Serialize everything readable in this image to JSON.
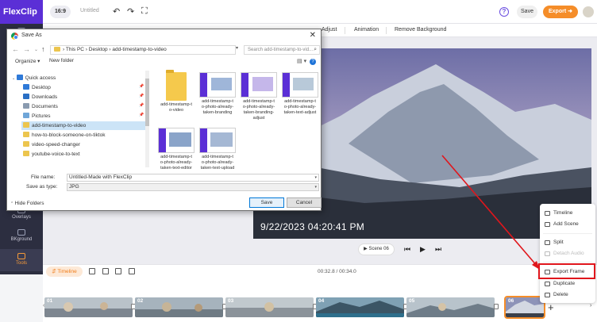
{
  "app": {
    "logo": "FlexClip",
    "aspect_ratio": "16:9",
    "project_title": "Untitled",
    "save_label": "Save",
    "export_label": "Export ➜",
    "accent_color": "#5b2fd6",
    "export_color": "#f58d29"
  },
  "sidebar": {
    "items": [
      {
        "label": "",
        "icon": "media-icon"
      },
      {
        "label": "",
        "icon": "template-icon"
      },
      {
        "label": "",
        "icon": "text-icon"
      },
      {
        "label": "",
        "icon": "subtitle-icon"
      },
      {
        "label": "",
        "icon": "element-icon"
      },
      {
        "label": "",
        "icon": "audio-icon"
      },
      {
        "label": "",
        "icon": "effect-icon"
      },
      {
        "label": "",
        "icon": "transition-icon"
      },
      {
        "label": "Overlays",
        "icon": "overlays-icon"
      },
      {
        "label": "BKground",
        "icon": "background-icon"
      },
      {
        "label": "Tools",
        "icon": "tools-icon"
      }
    ]
  },
  "tabs": [
    "Adjust",
    "Animation",
    "Remove Background"
  ],
  "canvas": {
    "timestamp_text": "9/22/2023 04:20:41 PM",
    "scene_label": "Scene 06"
  },
  "context_menu": {
    "items": [
      {
        "label": "Timeline",
        "icon": "timeline-icon",
        "disabled": false
      },
      {
        "label": "Add Scene",
        "icon": "add-scene-icon",
        "disabled": false
      },
      {
        "label": "Split",
        "icon": "split-icon",
        "disabled": false
      },
      {
        "label": "Detach Audio",
        "icon": "detach-audio-icon",
        "disabled": true
      },
      {
        "label": "Export Frame",
        "icon": "export-frame-icon",
        "disabled": false
      },
      {
        "label": "Duplicate",
        "icon": "duplicate-icon",
        "disabled": false
      },
      {
        "label": "Delete",
        "icon": "delete-icon",
        "disabled": false
      }
    ]
  },
  "timeline": {
    "label": "Timeline",
    "time_display": "00:32.8 / 00:34.0",
    "clips": [
      {
        "num": "01",
        "dur": ""
      },
      {
        "num": "02",
        "dur": ""
      },
      {
        "num": "03",
        "dur": ""
      },
      {
        "num": "04",
        "dur": ""
      },
      {
        "num": "05",
        "dur": ""
      },
      {
        "num": "06",
        "dur": ""
      }
    ]
  },
  "dialog": {
    "title": "Save As",
    "address": [
      "This PC",
      "Desktop",
      "add-timestamp-to-video"
    ],
    "search_placeholder": "Search add-timestamp-to-vid...",
    "organize_label": "Organize ▾",
    "new_folder_label": "New folder",
    "nav_items": [
      {
        "label": "Quick access",
        "icon": "star-icon"
      },
      {
        "label": "Desktop",
        "icon": "desktop-icon"
      },
      {
        "label": "Downloads",
        "icon": "downloads-icon"
      },
      {
        "label": "Documents",
        "icon": "documents-icon"
      },
      {
        "label": "Pictures",
        "icon": "pictures-icon"
      },
      {
        "label": "add-timestamp-to-video",
        "icon": "folder-icon"
      },
      {
        "label": "how-to-block-someone-on-tiktok",
        "icon": "folder-icon"
      },
      {
        "label": "video-speed-changer",
        "icon": "folder-icon"
      },
      {
        "label": "youtube-voice-to-text",
        "icon": "folder-icon"
      }
    ],
    "files": [
      {
        "name": "add-timestamp-t\no-video",
        "kind": "folder"
      },
      {
        "name": "add-timestamp-t\no-photo-already-\ntaken-branding",
        "kind": "image"
      },
      {
        "name": "add-timestamp-t\no-photo-already-\ntaken-branding-\nadjust",
        "kind": "image"
      },
      {
        "name": "add-timestamp-t\no-photo-already-\ntaken-text-adjust",
        "kind": "image"
      },
      {
        "name": "add-timestamp-t\no-photo-already-\ntaken-text-editor",
        "kind": "image"
      },
      {
        "name": "add-timestamp-t\no-photo-already-\ntaken-text-upload",
        "kind": "image"
      }
    ],
    "file_name_label": "File name:",
    "file_name_value": "Untitled-Made with FlexClip",
    "save_type_label": "Save as type:",
    "save_type_value": "JPG",
    "hide_folders_label": "Hide Folders",
    "save_button": "Save",
    "cancel_button": "Cancel"
  }
}
